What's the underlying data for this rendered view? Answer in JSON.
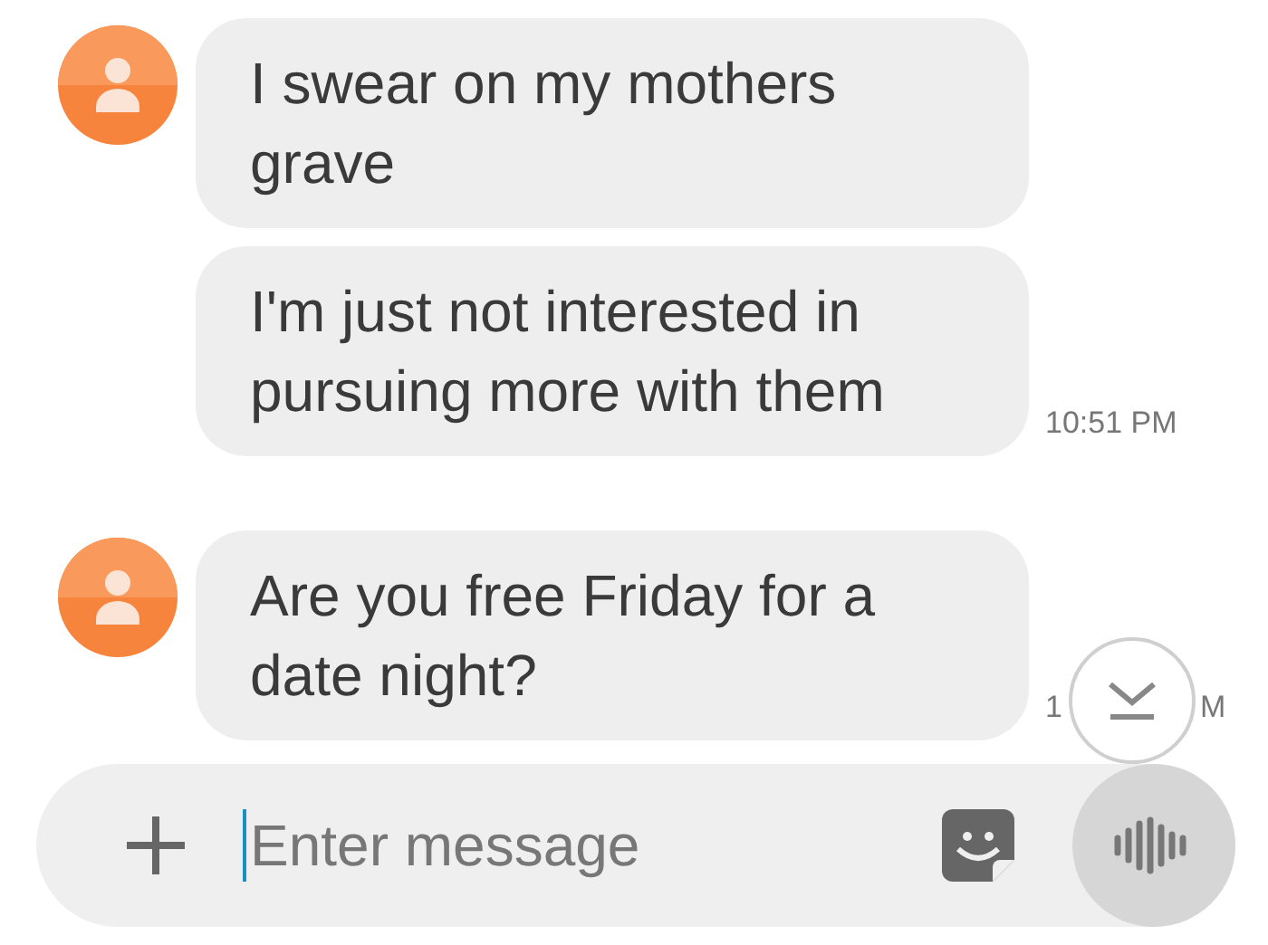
{
  "groups": [
    {
      "bubbles": [
        "I swear on my mothers grave",
        "I'm just not interested in pursuing more with them"
      ],
      "time": {
        "kind": "full",
        "text": "10:51 PM"
      }
    },
    {
      "bubbles": [
        "Are you free Friday for a date night?"
      ],
      "time": {
        "kind": "covered",
        "start": "1",
        "end": "M"
      }
    }
  ],
  "composer": {
    "placeholder": "Enter message"
  }
}
